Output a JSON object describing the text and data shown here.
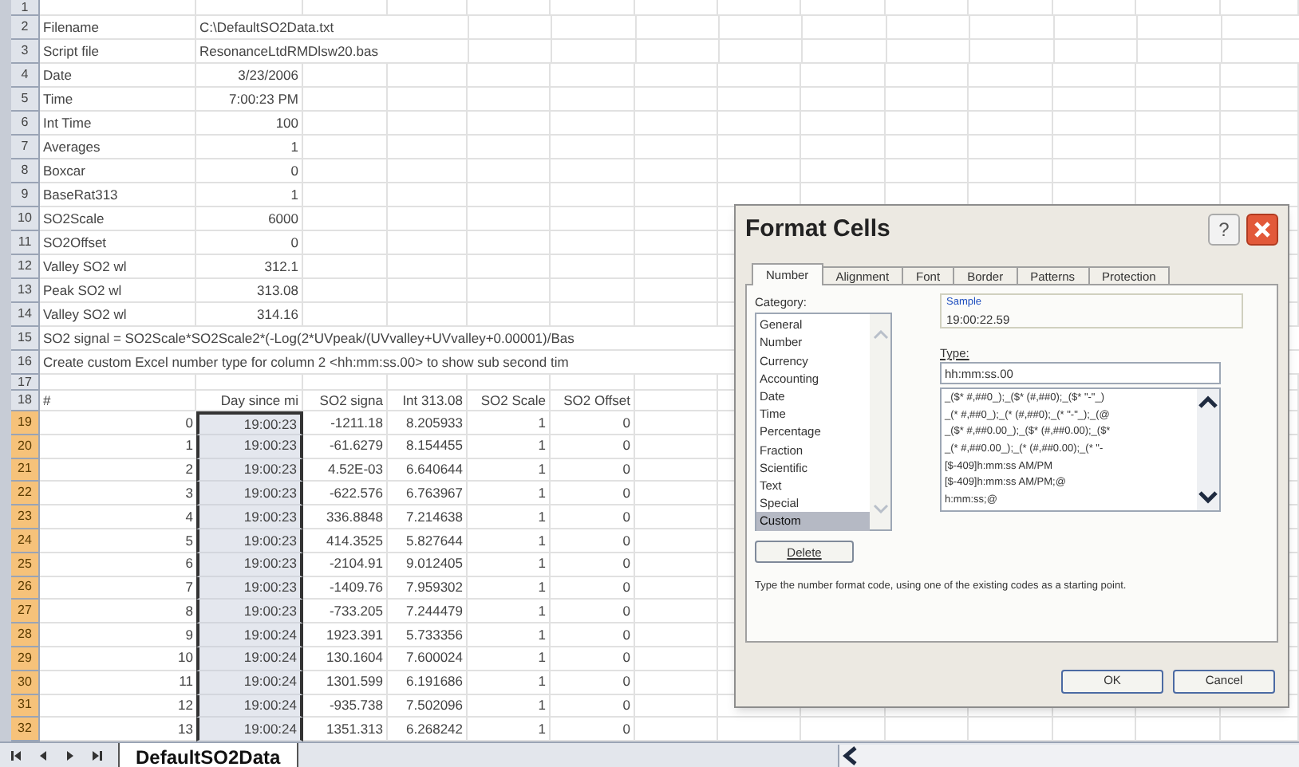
{
  "sheet": {
    "rows": [
      {
        "kind": "blank",
        "row": "1"
      },
      {
        "kind": "info",
        "row": "2",
        "label": "Filename",
        "value": "C:\\DefaultSO2Data.txt",
        "left_aligned": true
      },
      {
        "kind": "info",
        "row": "3",
        "label": "Script file",
        "value": "ResonanceLtdRMDlsw20.bas",
        "left_aligned": true
      },
      {
        "kind": "info",
        "row": "4",
        "label": "Date",
        "value": "3/23/2006",
        "left_aligned": false
      },
      {
        "kind": "info",
        "row": "5",
        "label": "Time",
        "value": "7:00:23 PM",
        "left_aligned": false
      },
      {
        "kind": "info",
        "row": "6",
        "label": "Int Time",
        "value": "100",
        "left_aligned": false
      },
      {
        "kind": "info",
        "row": "7",
        "label": "Averages",
        "value": "1",
        "left_aligned": false
      },
      {
        "kind": "info",
        "row": "8",
        "label": "Boxcar",
        "value": "0",
        "left_aligned": false
      },
      {
        "kind": "info",
        "row": "9",
        "label": "BaseRat313",
        "value": "1",
        "left_aligned": false
      },
      {
        "kind": "info",
        "row": "10",
        "label": "SO2Scale",
        "value": "6000",
        "left_aligned": false
      },
      {
        "kind": "info",
        "row": "11",
        "label": "SO2Offset",
        "value": "0",
        "left_aligned": false
      },
      {
        "kind": "info",
        "row": "12",
        "label": "Valley SO2 wl",
        "value": "312.1",
        "left_aligned": false
      },
      {
        "kind": "info",
        "row": "13",
        "label": "Peak SO2 wl",
        "value": "313.08",
        "left_aligned": false
      },
      {
        "kind": "info",
        "row": "14",
        "label": "Valley SO2 wl",
        "value": "314.16",
        "left_aligned": false
      },
      {
        "kind": "note",
        "row": "15",
        "text": "SO2 signal = SO2Scale*SO2Scale2*(-Log(2*UVpeak/(UVvalley+UVvalley+0.00001)/Bas"
      },
      {
        "kind": "note",
        "row": "16",
        "text": "Create custom Excel number type for column 2 <hh:mm:ss.00> to show sub second tim"
      },
      {
        "kind": "blank",
        "row": "17"
      },
      {
        "kind": "header",
        "row": "18",
        "cells": [
          "#",
          "Day since mi",
          "SO2 signa",
          "Int 313.08",
          "SO2 Scale",
          "SO2 Offset"
        ]
      },
      {
        "kind": "data",
        "row": "19",
        "selected": true,
        "cells": [
          "0",
          "19:00:23",
          "-1211.18",
          "8.205933",
          "1",
          "0"
        ]
      },
      {
        "kind": "data",
        "row": "20",
        "selected": true,
        "cells": [
          "1",
          "19:00:23",
          "-61.6279",
          "8.154455",
          "1",
          "0"
        ]
      },
      {
        "kind": "data",
        "row": "21",
        "selected": true,
        "cells": [
          "2",
          "19:00:23",
          "4.52E-03",
          "6.640644",
          "1",
          "0"
        ]
      },
      {
        "kind": "data",
        "row": "22",
        "selected": true,
        "cells": [
          "3",
          "19:00:23",
          "-622.576",
          "6.763967",
          "1",
          "0"
        ]
      },
      {
        "kind": "data",
        "row": "23",
        "selected": true,
        "cells": [
          "4",
          "19:00:23",
          "336.8848",
          "7.214638",
          "1",
          "0"
        ]
      },
      {
        "kind": "data",
        "row": "24",
        "selected": true,
        "cells": [
          "5",
          "19:00:23",
          "414.3525",
          "5.827644",
          "1",
          "0"
        ]
      },
      {
        "kind": "data",
        "row": "25",
        "selected": true,
        "cells": [
          "6",
          "19:00:23",
          "-2104.91",
          "9.012405",
          "1",
          "0"
        ]
      },
      {
        "kind": "data",
        "row": "26",
        "selected": true,
        "cells": [
          "7",
          "19:00:23",
          "-1409.76",
          "7.959302",
          "1",
          "0"
        ]
      },
      {
        "kind": "data",
        "row": "27",
        "selected": true,
        "cells": [
          "8",
          "19:00:23",
          "-733.205",
          "7.244479",
          "1",
          "0"
        ]
      },
      {
        "kind": "data",
        "row": "28",
        "selected": true,
        "cells": [
          "9",
          "19:00:24",
          "1923.391",
          "5.733356",
          "1",
          "0"
        ]
      },
      {
        "kind": "data",
        "row": "29",
        "selected": true,
        "cells": [
          "10",
          "19:00:24",
          "130.1604",
          "7.600024",
          "1",
          "0"
        ]
      },
      {
        "kind": "data",
        "row": "30",
        "selected": true,
        "cells": [
          "11",
          "19:00:24",
          "1301.599",
          "6.191686",
          "1",
          "0"
        ]
      },
      {
        "kind": "data",
        "row": "31",
        "selected": true,
        "cells": [
          "12",
          "19:00:24",
          "-935.738",
          "7.502096",
          "1",
          "0"
        ]
      },
      {
        "kind": "data",
        "row": "32",
        "selected": true,
        "cells": [
          "13",
          "19:00:24",
          "1351.313",
          "6.268242",
          "1",
          "0"
        ]
      }
    ],
    "sheet_tabs": [
      {
        "label": "DefaultSO2Data",
        "selected": true
      }
    ]
  },
  "dialog": {
    "title": "Format Cells",
    "help": "?",
    "tabs": [
      {
        "label": "Number",
        "selected": true
      },
      {
        "label": "Alignment",
        "selected": false
      },
      {
        "label": "Font",
        "selected": false
      },
      {
        "label": "Border",
        "selected": false
      },
      {
        "label": "Patterns",
        "selected": false
      },
      {
        "label": "Protection",
        "selected": false
      }
    ],
    "category_label": "Category:",
    "categories": [
      {
        "label": "General",
        "selected": false
      },
      {
        "label": "Number",
        "selected": false
      },
      {
        "label": "Currency",
        "selected": false
      },
      {
        "label": "Accounting",
        "selected": false
      },
      {
        "label": "Date",
        "selected": false
      },
      {
        "label": "Time",
        "selected": false
      },
      {
        "label": "Percentage",
        "selected": false
      },
      {
        "label": "Fraction",
        "selected": false
      },
      {
        "label": "Scientific",
        "selected": false
      },
      {
        "label": "Text",
        "selected": false
      },
      {
        "label": "Special",
        "selected": false
      },
      {
        "label": "Custom",
        "selected": true
      }
    ],
    "sample_label": "Sample",
    "sample": "19:00:22.59",
    "type_label": "Type:",
    "type_value": "hh:mm:ss.00",
    "formats": [
      "_($* #,##0_);_($* (#,##0);_($* \"-\"_)",
      "_(* #,##0_);_(* (#,##0);_(* \"-\"_);_(@",
      "_($* #,##0.00_);_($* (#,##0.00);_($*",
      "_(* #,##0.00_);_(* (#,##0.00);_(* \"-",
      "[$-409]h:mm:ss AM/PM",
      "[$-409]h:mm:ss AM/PM;@",
      "h:mm:ss;@"
    ],
    "delete_button": "Delete",
    "description": "Type the number format code, using one of the existing codes as a starting point.",
    "buttons": [
      "OK",
      "Cancel"
    ]
  }
}
